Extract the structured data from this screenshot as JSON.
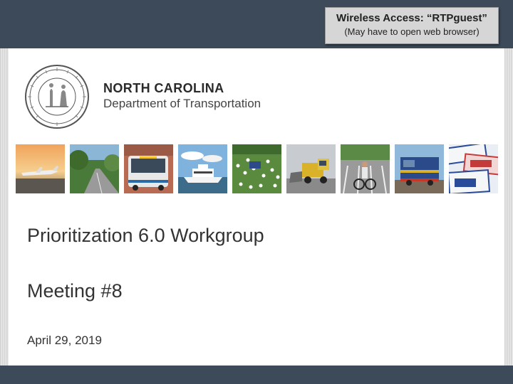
{
  "notice": {
    "line1": "Wireless Access: “RTPguest”",
    "line2": "(May have to open web browser)"
  },
  "header": {
    "org_name": "NORTH CAROLINA",
    "org_department": "Department of Transportation",
    "seal_icon": "state-seal-icon"
  },
  "photos": [
    {
      "name": "photo-airplane",
      "subject": "airplane"
    },
    {
      "name": "photo-road",
      "subject": "road"
    },
    {
      "name": "photo-bus",
      "subject": "bus"
    },
    {
      "name": "photo-ferry",
      "subject": "ferry"
    },
    {
      "name": "photo-wildflowers",
      "subject": "wildflowers"
    },
    {
      "name": "photo-snowplow",
      "subject": "snowplow"
    },
    {
      "name": "photo-cyclist",
      "subject": "cyclist"
    },
    {
      "name": "photo-train",
      "subject": "train"
    },
    {
      "name": "photo-license-plates",
      "subject": "license plates"
    }
  ],
  "slide": {
    "title": "Prioritization 6.0 Workgroup",
    "subtitle": "Meeting #8",
    "date": "April 29, 2019"
  },
  "colors": {
    "band": "#3d4a5a",
    "notice_bg": "#d6d6d6",
    "text": "#333333"
  }
}
